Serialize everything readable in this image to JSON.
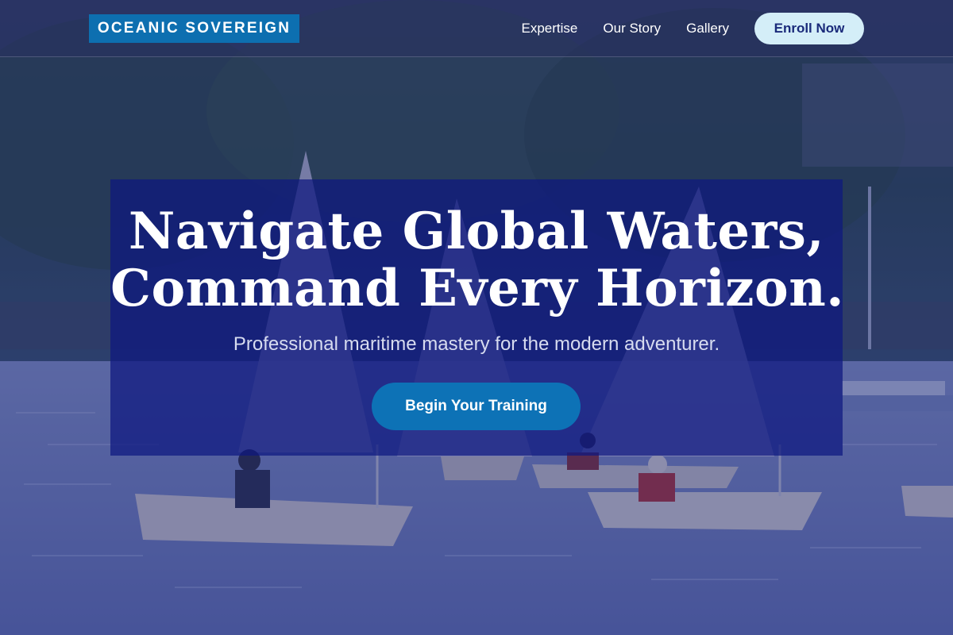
{
  "brand": {
    "logo_text": "OCEANIC SOVEREIGN"
  },
  "nav": {
    "links": [
      {
        "label": "Expertise"
      },
      {
        "label": "Our Story"
      },
      {
        "label": "Gallery"
      }
    ],
    "cta_label": "Enroll Now"
  },
  "hero": {
    "title_line_1": "Navigate Global Waters,",
    "title_line_2": "Command Every Horizon.",
    "subtitle": "Professional maritime mastery for the modern adventurer.",
    "cta_label": "Begin Your Training",
    "background_description_icon": "sailing-dinghies-photo"
  },
  "colors": {
    "logo_bg": "#0d6fb0",
    "enroll_bg": "#d4eef8",
    "enroll_text": "#1a2a7a",
    "card_bg": "#0e1880",
    "cta_bg": "#0d72b6"
  }
}
